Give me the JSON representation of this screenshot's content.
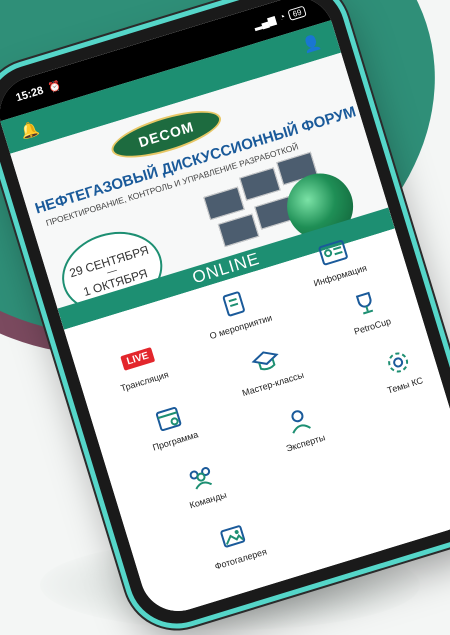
{
  "status_bar": {
    "time": "15:28",
    "alarm_icon": "alarm-icon",
    "battery": "69"
  },
  "app_bar": {
    "left_icon": "bell-icon",
    "right_icon": "user-icon",
    "color": "#1d8f72"
  },
  "banner": {
    "logo_text": "DECOM",
    "title": "НЕФТЕГАЗОВЫЙ ДИСКУССИОННЫЙ ФОРУМ",
    "subtitle": "ПРОЕКТИРОВАНИЕ, КОНТРОЛЬ И УПРАВЛЕНИЕ РАЗРАБОТКОЙ",
    "date_start": "29 СЕНТЯБРЯ",
    "date_dash": "—",
    "date_end": "1 ОКТЯБРЯ",
    "format": "ONLINE"
  },
  "menu": {
    "live": {
      "badge": "LIVE",
      "label": "Трансляция"
    },
    "about": {
      "label": "О мероприятии",
      "icon": "event-doc-icon"
    },
    "info": {
      "label": "Информация",
      "icon": "id-card-icon"
    },
    "program": {
      "label": "Программа",
      "icon": "calendar-icon"
    },
    "masterclass": {
      "label": "Мастер-классы",
      "icon": "graduation-cap-icon"
    },
    "petrocup": {
      "label": "PetroCup",
      "icon": "trophy-icon"
    },
    "teams": {
      "label": "Команды",
      "icon": "team-icon"
    },
    "experts": {
      "label": "Эксперты",
      "icon": "expert-icon"
    },
    "topics": {
      "label": "Темы КС",
      "icon": "topics-icon"
    },
    "gallery": {
      "label": "Фотогалерея",
      "icon": "photo-gallery-icon"
    }
  },
  "colors": {
    "accent": "#1d8f72",
    "teal_bg": "#2f8f78",
    "maroon_bg": "#7b4a5f",
    "phone_frame": "#55d6c9",
    "live_red": "#e3262c"
  }
}
